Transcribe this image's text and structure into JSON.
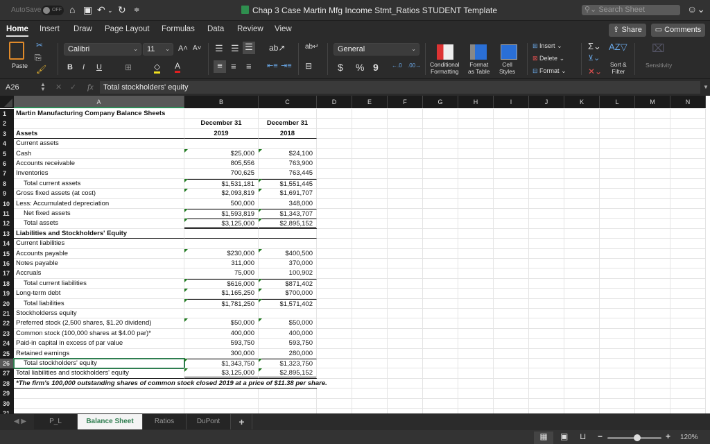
{
  "titlebar": {
    "autosave_label": "AutoSave",
    "autosave_state": "OFF",
    "doc_title": "Chap 3 Case Martin Mfg Income Stmt_Ratios STUDENT Template",
    "search_placeholder": "Search Sheet"
  },
  "ribbon_tabs": [
    "Home",
    "Insert",
    "Draw",
    "Page Layout",
    "Formulas",
    "Data",
    "Review",
    "View"
  ],
  "active_tab": "Home",
  "share_label": "Share",
  "comments_label": "Comments",
  "ribbon": {
    "paste_label": "Paste",
    "font_name": "Calibri",
    "font_size": "11",
    "number_format": "General",
    "conditional_formatting": "Conditional\nFormatting",
    "cf_line1": "Conditional",
    "cf_line2": "Formatting",
    "fat_line1": "Format",
    "fat_line2": "as Table",
    "cs_line1": "Cell",
    "cs_line2": "Styles",
    "insert_label": "Insert",
    "delete_label": "Delete",
    "format_label": "Format",
    "sort_line1": "Sort &",
    "sort_line2": "Filter",
    "sensitivity_label": "Sensitivity",
    "bold": "B",
    "italic": "I",
    "underline": "U",
    "dollar": "$",
    "percent": "%",
    "comma": "9"
  },
  "formula_bar": {
    "cell_ref": "A26",
    "fx": "fx",
    "content": "Total stockholders' equity"
  },
  "columns": [
    "A",
    "B",
    "C",
    "D",
    "E",
    "F",
    "G",
    "H",
    "I",
    "J",
    "K",
    "L",
    "M",
    "N"
  ],
  "selected_column": "A",
  "selected_row": 26,
  "rows": [
    {
      "n": "1",
      "a": "Martin Manufacturing Company Balance Sheets",
      "b": "",
      "c": ""
    },
    {
      "n": "2",
      "a": "",
      "b": "December 31",
      "c": "December 31"
    },
    {
      "n": "3",
      "a": "Assets",
      "b": "2019",
      "c": "2018"
    },
    {
      "n": "4",
      "a": "Current assets",
      "b": "",
      "c": ""
    },
    {
      "n": "5",
      "a": "Cash",
      "b": "$25,000",
      "c": "$24,100"
    },
    {
      "n": "6",
      "a": "Accounts receivable",
      "b": "805,556",
      "c": "763,900"
    },
    {
      "n": "7",
      "a": "Inventories",
      "b": "700,625",
      "c": "763,445"
    },
    {
      "n": "8",
      "a": "Total current assets",
      "b": "$1,531,181",
      "c": "$1,551,445"
    },
    {
      "n": "9",
      "a": "Gross fixed assets (at cost)",
      "b": "$2,093,819",
      "c": "$1,691,707"
    },
    {
      "n": "10",
      "a": "Less: Accumulated depreciation",
      "b": "500,000",
      "c": "348,000"
    },
    {
      "n": "11",
      "a": "Net fixed assets",
      "b": "$1,593,819",
      "c": "$1,343,707"
    },
    {
      "n": "12",
      "a": "Total assets",
      "b": "$3,125,000",
      "c": "$2,895,152"
    },
    {
      "n": "13",
      "a": "Liabilities and Stockholders' Equity",
      "b": "",
      "c": ""
    },
    {
      "n": "14",
      "a": "Current liabilities",
      "b": "",
      "c": ""
    },
    {
      "n": "15",
      "a": "Accounts payable",
      "b": "$230,000",
      "c": "$400,500"
    },
    {
      "n": "16",
      "a": "Notes payable",
      "b": "311,000",
      "c": "370,000"
    },
    {
      "n": "17",
      "a": "Accruals",
      "b": "75,000",
      "c": "100,902"
    },
    {
      "n": "18",
      "a": "Total current liabilities",
      "b": "$616,000",
      "c": "$871,402"
    },
    {
      "n": "19",
      "a": "Long-term debt",
      "b": "$1,165,250",
      "c": "$700,000"
    },
    {
      "n": "20",
      "a": "Total liabilities",
      "b": "$1,781,250",
      "c": "$1,571,402"
    },
    {
      "n": "21",
      "a": "Stockholderss equity",
      "b": "",
      "c": ""
    },
    {
      "n": "22",
      "a": "Preferred stock (2,500 shares, $1.20 dividend)",
      "b": "$50,000",
      "c": "$50,000"
    },
    {
      "n": "23",
      "a": "Common stock (100,000 shares at $4.00 par)*",
      "b": "400,000",
      "c": "400,000"
    },
    {
      "n": "24",
      "a": "Paid-in capital in excess of par value",
      "b": "593,750",
      "c": "593,750"
    },
    {
      "n": "25",
      "a": "Retained earnings",
      "b": "300,000",
      "c": "280,000"
    },
    {
      "n": "26",
      "a": "Total stockholders' equity",
      "b": "$1,343,750",
      "c": "$1,323,750"
    },
    {
      "n": "27",
      "a": "Total liabilities and stockholders' equity",
      "b": "$3,125,000",
      "c": "$2,895,152"
    },
    {
      "n": "28",
      "a": "*The firm's 100,000 outstanding shares of common stock closed 2019 at a price of  $11.38 per share.",
      "b": "",
      "c": ""
    },
    {
      "n": "29",
      "a": "",
      "b": "",
      "c": ""
    },
    {
      "n": "30",
      "a": "",
      "b": "",
      "c": ""
    },
    {
      "n": "31",
      "a": "",
      "b": "",
      "c": ""
    }
  ],
  "sheet_tabs": [
    "P_L",
    "Balance Sheet",
    "Ratios",
    "DuPont"
  ],
  "active_sheet": "Balance Sheet",
  "add_sheet": "+",
  "zoom_level": "120%",
  "zoom_fraction": 0.55
}
